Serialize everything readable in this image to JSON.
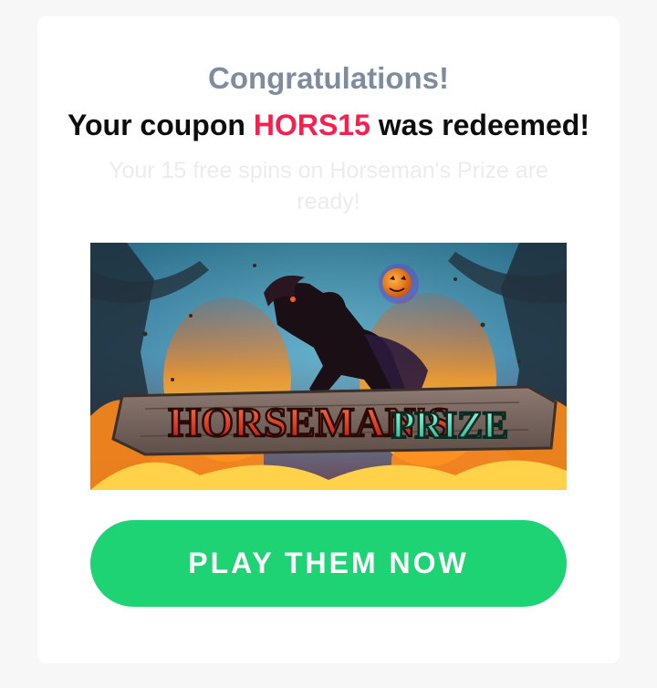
{
  "card": {
    "heading": "Congratulations!",
    "message_prefix": "Your coupon ",
    "coupon_code": "HORS15",
    "message_suffix": " was redeemed!",
    "subtext": "Your 15 free spins on Horseman's Prize are ready!"
  },
  "banner": {
    "logo_word1": "HORSEMAN'S",
    "logo_word2": "PRIZE"
  },
  "cta": {
    "label": "PLAY THEM NOW"
  },
  "colors": {
    "page_background": "#f7f7f7",
    "card_background": "#ffffff",
    "heading": "#7e8c9d",
    "coupon_code": "#f5204e",
    "subtext": "#ececec",
    "button": "#1ed374"
  }
}
